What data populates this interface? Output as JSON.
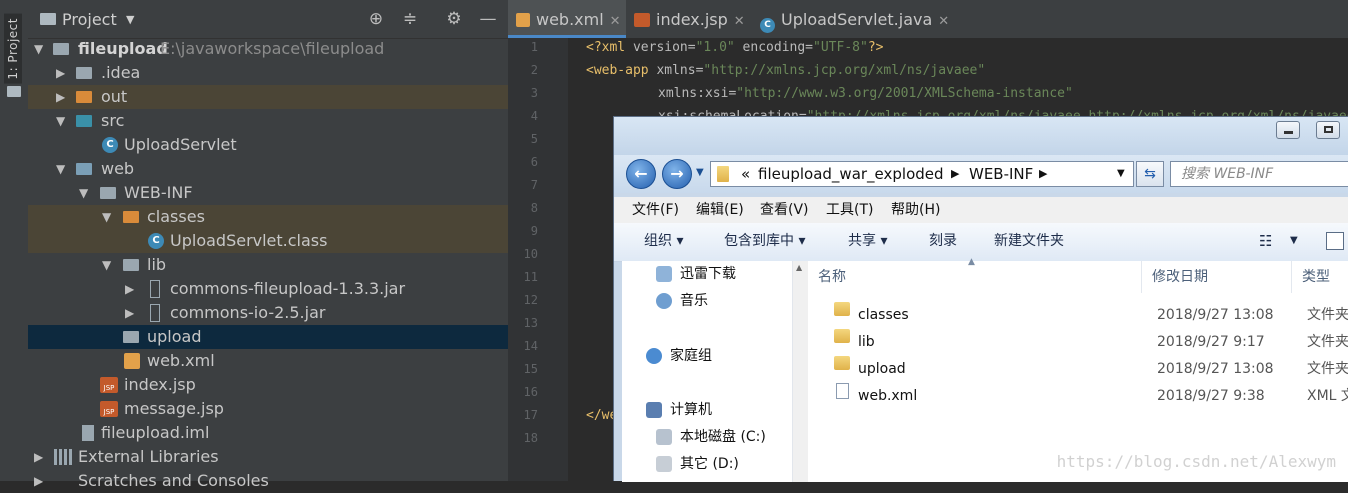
{
  "sidebar_strip": {
    "label": "1: Project"
  },
  "project_panel": {
    "title": "Project",
    "tree": [
      {
        "name": "fileupload",
        "path": "E:\\javaworkspace\\fileupload"
      },
      {
        "name": ".idea"
      },
      {
        "name": "out"
      },
      {
        "name": "src"
      },
      {
        "name": "UploadServlet"
      },
      {
        "name": "web"
      },
      {
        "name": "WEB-INF"
      },
      {
        "name": "classes"
      },
      {
        "name": "UploadServlet.class"
      },
      {
        "name": "lib"
      },
      {
        "name": "commons-fileupload-1.3.3.jar"
      },
      {
        "name": "commons-io-2.5.jar"
      },
      {
        "name": "upload"
      },
      {
        "name": "web.xml"
      },
      {
        "name": "index.jsp"
      },
      {
        "name": "message.jsp"
      },
      {
        "name": "fileupload.iml"
      },
      {
        "name": "External Libraries"
      },
      {
        "name": "Scratches and Consoles"
      }
    ]
  },
  "editor": {
    "tabs": [
      {
        "label": "web.xml",
        "active": true
      },
      {
        "label": "index.jsp",
        "active": false
      },
      {
        "label": "UploadServlet.java",
        "active": false
      }
    ],
    "line_numbers": [
      "1",
      "2",
      "3",
      "4",
      "5",
      "6",
      "7",
      "8",
      "9",
      "10",
      "11",
      "12",
      "13",
      "14",
      "15",
      "16",
      "17",
      "18"
    ],
    "code": {
      "l1_a": "<?xml ",
      "l1_b": "version=",
      "l1_c": "\"1.0\"",
      "l1_d": " encoding=",
      "l1_e": "\"UTF-8\"",
      "l1_f": "?>",
      "l2_a": "<web-app ",
      "l2_b": "xmlns=",
      "l2_c": "\"http://xmlns.jcp.org/xml/ns/javaee\"",
      "l3_b": "xmlns:xsi=",
      "l3_c": "\"http://www.w3.org/2001/XMLSchema-instance\"",
      "l4_b": "xsi:schemaLocation=",
      "l4_c": "\"http://xmlns.jcp.org/xml/ns/javaee http://xmlns.jcp.org/xml/ns/javaee\"",
      "l17": "</we"
    }
  },
  "explorer": {
    "address": {
      "prefix": "«",
      "crumbs": [
        "fileupload_war_exploded",
        "WEB-INF"
      ]
    },
    "search_placeholder": "搜索 WEB-INF",
    "menu": [
      "文件(F)",
      "编辑(E)",
      "查看(V)",
      "工具(T)",
      "帮助(H)"
    ],
    "toolbar": [
      "组织 ▾",
      "包含到库中 ▾",
      "共享 ▾",
      "刻录",
      "新建文件夹"
    ],
    "nav_items": [
      "迅雷下载",
      "音乐",
      "家庭组",
      "计算机",
      "本地磁盘 (C:)",
      "其它 (D:)"
    ],
    "columns": [
      "名称",
      "修改日期",
      "类型"
    ],
    "files": [
      {
        "name": "classes",
        "date": "2018/9/27 13:08",
        "type": "文件夹"
      },
      {
        "name": "lib",
        "date": "2018/9/27 9:17",
        "type": "文件夹"
      },
      {
        "name": "upload",
        "date": "2018/9/27 13:08",
        "type": "文件夹"
      },
      {
        "name": "web.xml",
        "date": "2018/9/27 9:38",
        "type": "XML 文档"
      }
    ]
  },
  "watermark": "https://blog.csdn.net/Alexwym"
}
